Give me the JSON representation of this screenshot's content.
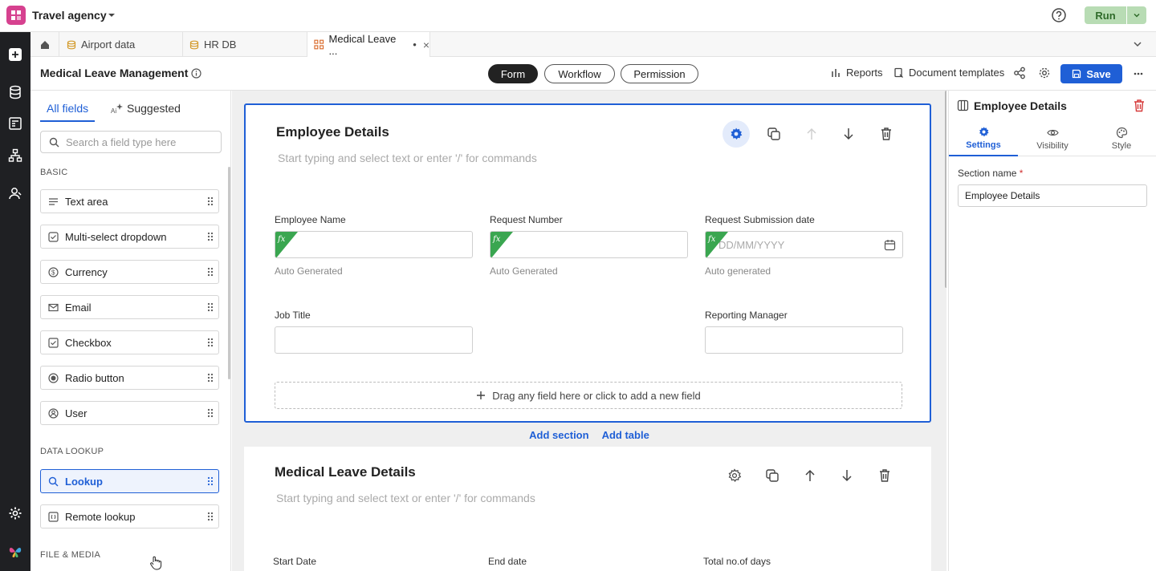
{
  "app": {
    "name": "Travel agency",
    "run_label": "Run"
  },
  "tabs": [
    {
      "label": "Airport data"
    },
    {
      "label": "HR DB"
    },
    {
      "label": "Medical Leave ...",
      "active": true,
      "dirty_marker": "•",
      "close": "×"
    }
  ],
  "header": {
    "title": "Medical Leave Management",
    "segments": [
      "Form",
      "Workflow",
      "Permission"
    ],
    "active_segment": "Form",
    "reports_label": "Reports",
    "doc_templates_label": "Document templates",
    "save_label": "Save"
  },
  "left_panel": {
    "tabs": {
      "all": "All fields",
      "suggested": "Suggested"
    },
    "search_placeholder": "Search a field type here",
    "categories": {
      "basic": "BASIC",
      "lookup": "DATA LOOKUP",
      "media": "FILE & MEDIA"
    },
    "basic_fields": [
      {
        "label": "Text area",
        "icon": "text-area-icon"
      },
      {
        "label": "Multi-select dropdown",
        "icon": "multi-select-icon"
      },
      {
        "label": "Currency",
        "icon": "currency-icon"
      },
      {
        "label": "Email",
        "icon": "email-icon"
      },
      {
        "label": "Checkbox",
        "icon": "checkbox-icon"
      },
      {
        "label": "Radio button",
        "icon": "radio-icon"
      },
      {
        "label": "User",
        "icon": "user-icon"
      }
    ],
    "lookup_fields": [
      {
        "label": "Lookup",
        "icon": "lookup-icon",
        "highlighted": true
      },
      {
        "label": "Remote lookup",
        "icon": "remote-lookup-icon"
      }
    ]
  },
  "canvas": {
    "sections": [
      {
        "title": "Employee Details",
        "description_placeholder": "Start typing and select text or enter '/' for commands",
        "fields": [
          {
            "label": "Employee Name",
            "hint": "Auto Generated",
            "formula": true
          },
          {
            "label": "Request Number",
            "hint": "Auto Generated",
            "formula": true
          },
          {
            "label": "Request Submission date",
            "hint": "Auto generated",
            "formula": true,
            "placeholder": "DD/MM/YYYY"
          },
          {
            "label": "Job Title"
          },
          {
            "label": "Reporting Manager"
          }
        ],
        "dropzone_label": "Drag any field here or click to add a new field"
      },
      {
        "title": "Medical Leave Details",
        "description_placeholder": "Start typing and select text or enter '/' for commands",
        "fields": [
          {
            "label": "Start Date"
          },
          {
            "label": "End date"
          },
          {
            "label": "Total no.of days"
          }
        ]
      }
    ],
    "add_section_label": "Add section",
    "add_table_label": "Add table",
    "fx_label": "fx"
  },
  "right_panel": {
    "title": "Employee Details",
    "tabs": [
      "Settings",
      "Visibility",
      "Style"
    ],
    "active_tab": "Settings",
    "section_name_label": "Section name",
    "required_marker": "*",
    "section_name_value": "Employee Details"
  },
  "colors": {
    "accent": "#1f5fd6",
    "run_bg": "#b8dcb4",
    "app_logo": "#d6418f",
    "rail_bg": "#1f2023"
  }
}
